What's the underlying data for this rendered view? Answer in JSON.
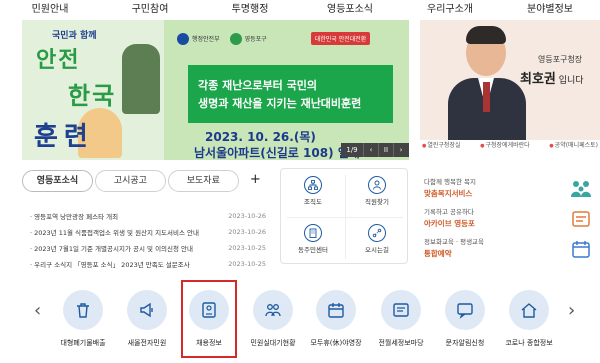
{
  "topnav": [
    "민원안내",
    "구민참여",
    "투명행정",
    "영등포소식",
    "우리구소개",
    "분야별정보"
  ],
  "banner": {
    "poster_line1": "국민과 함께",
    "poster_line2": "안전",
    "poster_line3": "한국",
    "poster_line4": "훈련",
    "logo1": "행정안전부",
    "logo2": "영등포구",
    "campaign": "대한민국 안전대전환",
    "headline1": "각종 재난으로부터 국민의",
    "headline2": "생명과 재산을 지키는 재난대비훈련",
    "date": "2023. 10. 26.(목)",
    "place": "남서울아파트(신길로 108) 일대",
    "counter": "1/9",
    "prev": "‹",
    "pause": "II",
    "next": "›"
  },
  "mayor": {
    "title": "영등포구청장",
    "name": "최호권",
    "suffix": " 입니다",
    "links": [
      "열린구청장실",
      "구청장에게바란다",
      "공약(매니페스토)"
    ]
  },
  "news": {
    "tabs": [
      "영등포소식",
      "고시공고",
      "보도자료"
    ],
    "more": "+",
    "items": [
      {
        "title": "영등포역 낭만광장 페스타 개최",
        "date": "2023-10-26"
      },
      {
        "title": "2023년 11월 식품접객업소 위생 및 원산지 지도서비스 안내",
        "date": "2023-10-26"
      },
      {
        "title": "2023년 7월1일 기준 개별공시지가 공시 및 이의신청 안내",
        "date": "2023-10-25"
      },
      {
        "title": "우리구 소식지 「영등포 소식」 2023년 만족도 설문조사",
        "date": "2023-10-25"
      }
    ]
  },
  "quick": [
    "조직도",
    "직원찾기",
    "동주민센터",
    "오시는길"
  ],
  "services": [
    {
      "sub": "다함께 행복한 복지",
      "title": "맞춤복지서비스"
    },
    {
      "sub": "기록하고 공유하다",
      "title": "아카이브 영등포"
    },
    {
      "sub": "정보화교육 · 평생교육",
      "title": "통합예약"
    }
  ],
  "carousel": {
    "prev": "‹",
    "next": "›",
    "items": [
      "대형폐기물배출",
      "새올전자민원",
      "채용정보",
      "민원실대기현황",
      "모두휴(休)야영장",
      "전월세정보마당",
      "문자알림신청",
      "코로나 종합정보"
    ]
  },
  "colors": {
    "accent_green": "#1ca64b",
    "navy": "#1d3a8a",
    "highlight_red": "#d42a2a",
    "service_orange": "#d05a2a",
    "icon_blue": "#1e5aa0",
    "circle_bg": "#dfe9f5"
  }
}
